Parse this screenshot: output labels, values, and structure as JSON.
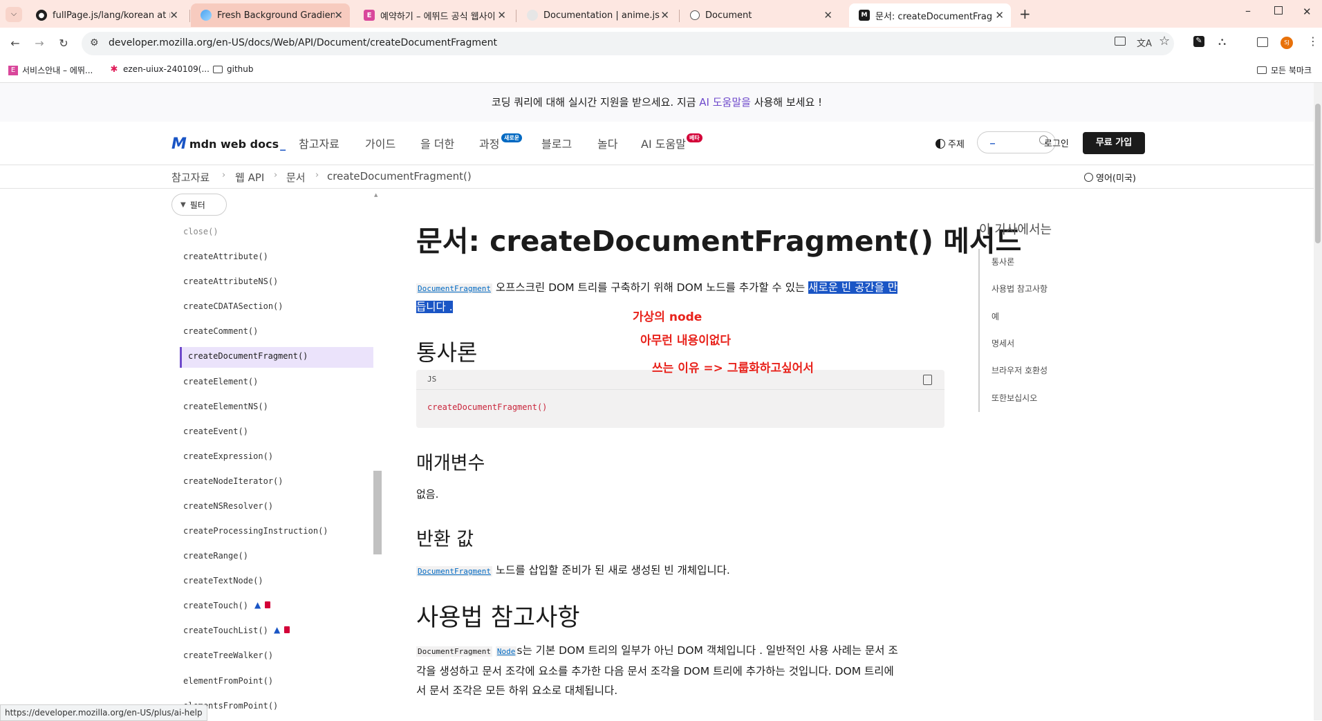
{
  "browser": {
    "tabs": [
      {
        "title": "fullPage.js/lang/korean at mas",
        "favicon": "github"
      },
      {
        "title": "Fresh Background Gradients |",
        "favicon": "gradient"
      },
      {
        "title": "예약하기 – 에뛰드 공식 웹사이",
        "favicon": "E"
      },
      {
        "title": "Documentation | anime.js",
        "favicon": "anime"
      },
      {
        "title": "Document",
        "favicon": "globe"
      },
      {
        "title": "문서: createDocumentFragmen",
        "favicon": "mdn"
      }
    ],
    "url": "developer.mozilla.org/en-US/docs/Web/API/Document/createDocumentFragment",
    "bookmarks": [
      {
        "label": "서비스안내 – 에뛰...",
        "icon": "E"
      },
      {
        "label": "ezen-uiux-240109(...",
        "icon": "slack"
      },
      {
        "label": "github",
        "icon": "folder"
      }
    ],
    "all_bookmarks": "모든 북마크",
    "profile_initials": "SJ",
    "status_url": "https://developer.mozilla.org/en-US/plus/ai-help"
  },
  "banner": {
    "prefix": "코딩 쿼리에 대해 실시간 지원을 받으세요. 지금 ",
    "link": "AI 도움말을",
    "suffix": " 사용해 보세요 !"
  },
  "header": {
    "logo": "mdn web docs",
    "nav": [
      "참고자료",
      "가이드",
      "을 더한",
      "과정",
      "블로그",
      "놀다",
      "AI 도움말"
    ],
    "badge_new": "새로운",
    "badge_beta": "베타",
    "theme": "주제",
    "search_placeholder": "_",
    "login": "로그인",
    "signup": "무료 가입"
  },
  "breadcrumbs": [
    "참고자료",
    "웹 API",
    "문서",
    "createDocumentFragment()"
  ],
  "language": "영어(미국)",
  "sidebar": {
    "filter": "필터",
    "items": [
      "close()",
      "createAttribute()",
      "createAttributeNS()",
      "createCDATASection()",
      "createComment()",
      "createDocumentFragment()",
      "createElement()",
      "createElementNS()",
      "createEvent()",
      "createExpression()",
      "createNodeIterator()",
      "createNSResolver()",
      "createProcessingInstruction()",
      "createRange()",
      "createTextNode()",
      "createTouch()",
      "createTouchList()",
      "createTreeWalker()",
      "elementFromPoint()",
      "elementsFromPoint()"
    ],
    "active_index": 5
  },
  "article": {
    "title": "문서: createDocumentFragment() 메서드",
    "intro_link": "DocumentFragment",
    "intro_text": " 오프스크린 DOM 트리를 구축하기 위해 DOM 노드를 추가할 수 있는 ",
    "intro_highlight_1": "새로운 빈 공간을 만",
    "intro_highlight_2": "듭니다 .",
    "h_syntax": "통사론",
    "code_lang": "JS",
    "code": "createDocumentFragment()",
    "h_params": "매개변수",
    "params": "없음.",
    "h_return": "반환 값",
    "return_link": "DocumentFragment",
    "return_text": " 노드를 삽입할 준비가 된 새로 생성된 빈 개체입니다.",
    "h_usage": "사용법 참고사항",
    "usage_code": "DocumentFragment",
    "usage_link": "Node",
    "usage_line1": "s는 기본 DOM 트리의 일부가 아닌 DOM 객체입니다 . 일반적인 사용 사례는 문서 조",
    "usage_line2": "각을 생성하고 문서 조각에 요소를 추가한 다음 문서 조각을 DOM 트리에 추가하는 것입니다. DOM 트리에",
    "usage_line3": "서 문서 조각은 모든 하위 요소로 대체됩니다."
  },
  "annotations": [
    "가상의 node",
    "아무런 내용이없다",
    "쓰는 이유 => 그룹화하고싶어서"
  ],
  "toc": {
    "title": "이 기사에서는",
    "items": [
      "통사론",
      "사용법 참고사항",
      "예",
      "명세서",
      "브라우저 호환성",
      "또한보십시오"
    ]
  },
  "colors": {
    "tabstrip": "#fde7e1",
    "accent": "#6e49cb",
    "link": "#0069c2",
    "highlight": "#1a55c5",
    "annotation": "#e8221b"
  }
}
